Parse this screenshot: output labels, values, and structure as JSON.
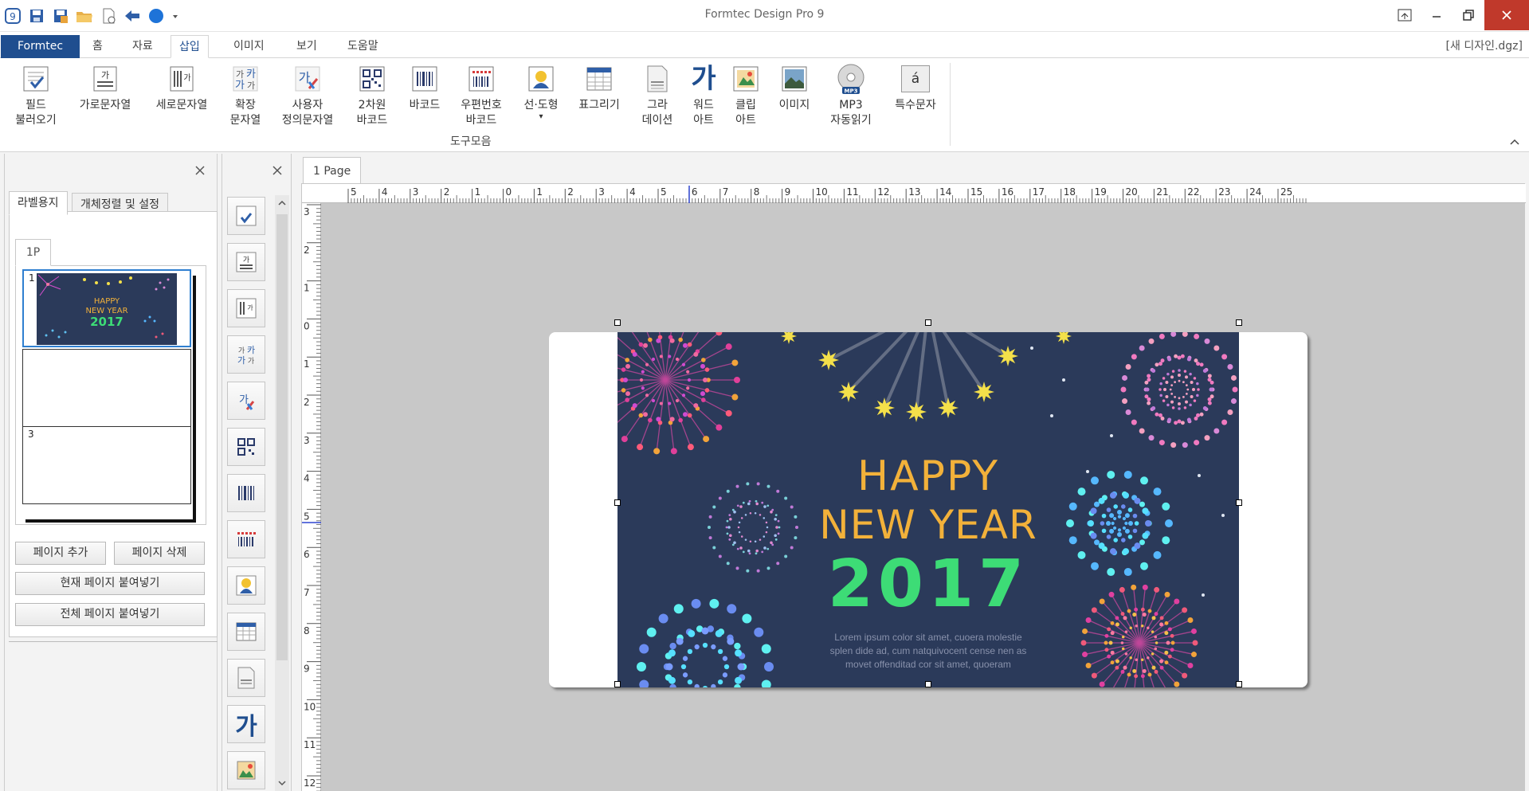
{
  "window": {
    "title": "Formtec Design Pro 9",
    "doc_name": "[새 디자인.dgz]"
  },
  "quick_access": {
    "icons": [
      "app-icon",
      "save-icon",
      "save-as-icon",
      "open-folder-icon",
      "new-document-icon",
      "back-arrow-icon",
      "blue-circle-icon",
      "dropdown-icon"
    ]
  },
  "ribbon_tabs": {
    "app": "Formtec",
    "home": "홈",
    "data": "자료",
    "insert": "삽입",
    "image": "이미지",
    "view": "보기",
    "help": "도움말"
  },
  "ribbon": {
    "group_label": "도구모음",
    "buttons": [
      {
        "label1": "필드",
        "label2": "불러오기"
      },
      {
        "label1": "가로문자열",
        "label2": ""
      },
      {
        "label1": "세로문자열",
        "label2": ""
      },
      {
        "label1": "확장",
        "label2": "문자열"
      },
      {
        "label1": "사용자",
        "label2": "정의문자열"
      },
      {
        "label1": "2차원",
        "label2": "바코드"
      },
      {
        "label1": "바코드",
        "label2": ""
      },
      {
        "label1": "우편번호",
        "label2": "바코드"
      },
      {
        "label1": "선·도형",
        "label2": ""
      },
      {
        "label1": "표그리기",
        "label2": ""
      },
      {
        "label1": "그라",
        "label2": "데이션"
      },
      {
        "label1": "워드",
        "label2": "아트"
      },
      {
        "label1": "클립",
        "label2": "아트"
      },
      {
        "label1": "이미지",
        "label2": ""
      },
      {
        "label1": "MP3",
        "label2": "자동읽기"
      },
      {
        "label1": "특수문자",
        "label2": ""
      }
    ],
    "wordart_glyph": "가",
    "special_char_glyph": "á",
    "mp3_badge": "MP3",
    "shape_dropdown_glyph": "▾"
  },
  "left_panel": {
    "tab_label_paper": "라벨용지",
    "tab_object_settings": "개체정렬 및 설정",
    "page_tab": "1P",
    "thumbnails": [
      {
        "num": "1",
        "happy": "HAPPY",
        "newyear": "NEW YEAR",
        "year": "2017"
      },
      {
        "num": ""
      },
      {
        "num": "3"
      }
    ],
    "btn_add_page": "페이지 추가",
    "btn_delete_page": "페이지 삭제",
    "btn_paste_current": "현재 페이지 붙여넣기",
    "btn_paste_all": "전체 페이지 붙여넣기"
  },
  "tool_strip": {
    "wordart_glyph": "가"
  },
  "canvas": {
    "page_tab": "1 Page",
    "hruler_labels": [
      "5",
      "4",
      "3",
      "2",
      "1",
      "0",
      "1",
      "2",
      "3",
      "4",
      "5",
      "6",
      "7",
      "8",
      "9",
      "10",
      "11",
      "12",
      "13",
      "14",
      "15",
      "16",
      "17",
      "18",
      "19",
      "20",
      "21",
      "22",
      "23",
      "24",
      "25"
    ],
    "vruler_labels": [
      "3",
      "2",
      "1",
      "0",
      "1",
      "2",
      "3",
      "4",
      "5",
      "6",
      "7",
      "8",
      "9",
      "10",
      "11",
      "12"
    ],
    "design": {
      "happy": "HAPPY",
      "newyear": "NEW YEAR",
      "year": "2017",
      "lorem": "Lorem ipsum color sit amet, cuoera molestie splen dide ad, cum natquivocent cense nen as movet offenditad cor sit amet, quoeram"
    }
  },
  "colors": {
    "accent": "#1f4e8f",
    "design_bg": "#2b3a5a",
    "gold": "#f2b13a",
    "green": "#3ddc76",
    "close_red": "#c0392b"
  }
}
